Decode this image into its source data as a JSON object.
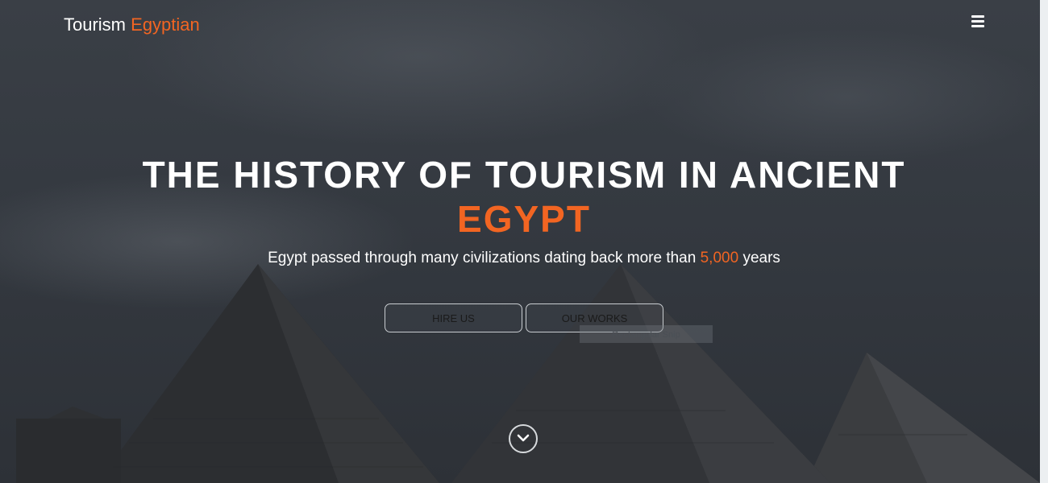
{
  "brand": {
    "part1": "Tourism",
    "part2": "Egyptian"
  },
  "nav": {
    "menu_icon": "hamburger-menu-icon"
  },
  "hero": {
    "title_line1": "THE HISTORY OF TOURISM IN ANCIENT",
    "title_line2": "EGYPT",
    "subtitle_before": "Egypt passed through many civilizations dating back more than",
    "subtitle_highlight": "5,000",
    "subtitle_after": "years",
    "buttons": {
      "hire": "HIRE US",
      "works": "OUR WORKS"
    },
    "tooltip": "Rectangular Snip",
    "scroll_icon": "chevron-down-icon"
  },
  "colors": {
    "accent": "#f26522",
    "text": "#ffffff",
    "overlay": "#343940"
  }
}
